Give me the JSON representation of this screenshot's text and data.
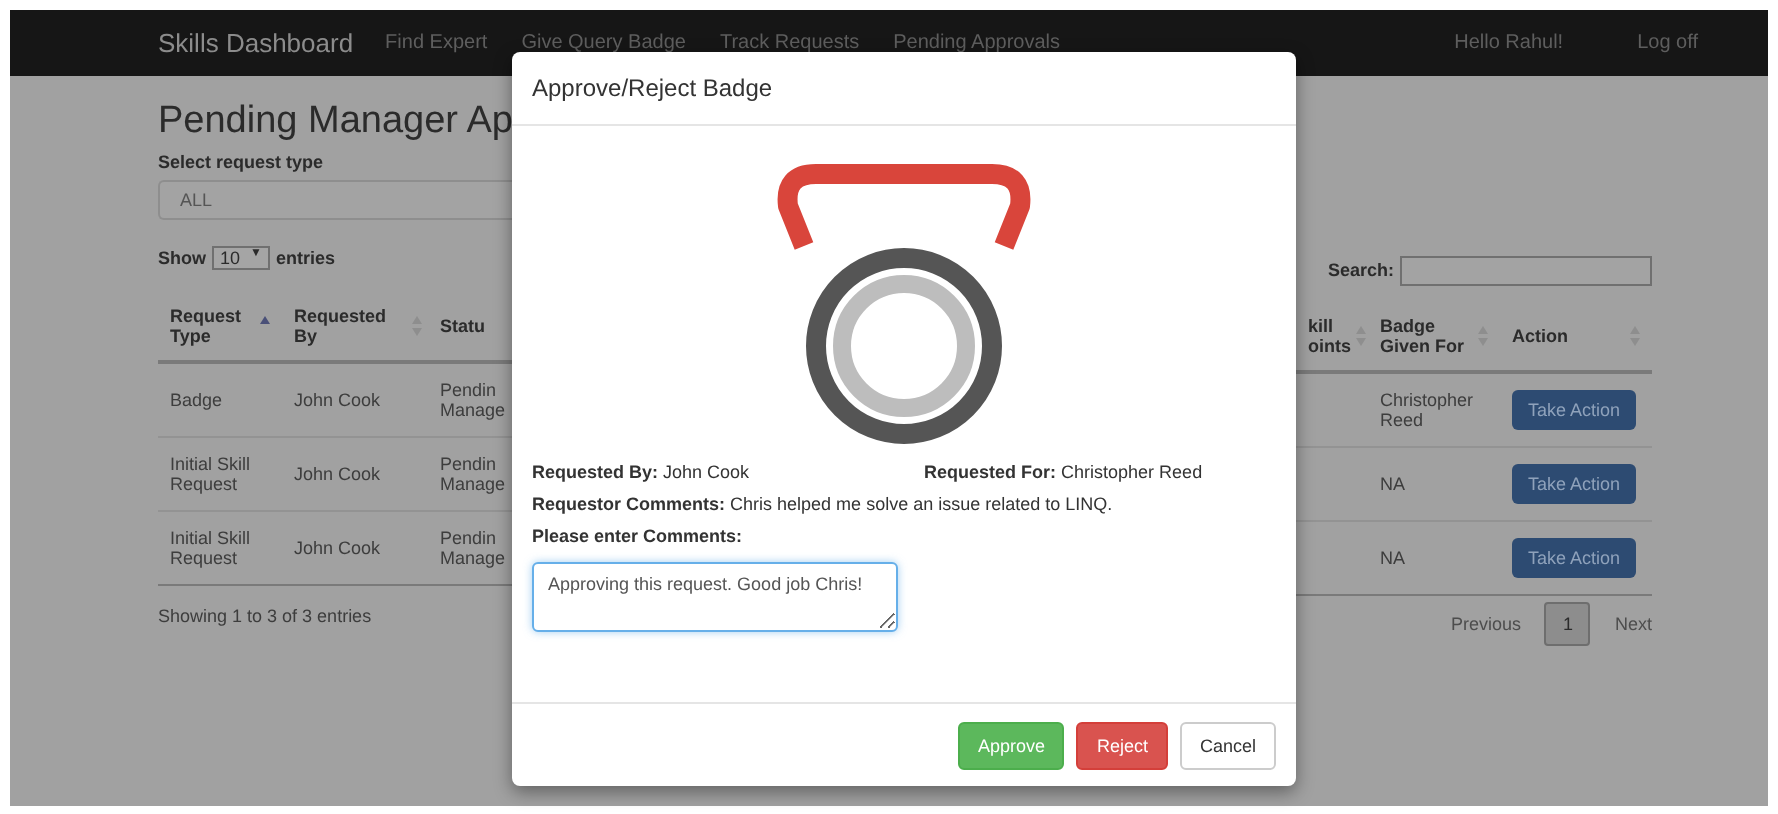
{
  "navbar": {
    "brand": "Skills Dashboard",
    "links": [
      "Find Expert",
      "Give Query Badge",
      "Track Requests",
      "Pending Approvals"
    ],
    "greeting": "Hello Rahul!",
    "logout": "Log off"
  },
  "page": {
    "title": "Pending Manager Ap",
    "filter_label": "Select request type",
    "filter_value": "ALL",
    "length_prefix": "Show",
    "length_value": "10",
    "length_suffix": "entries",
    "search_label": "Search:",
    "length_caret": "▼",
    "table_left": {
      "columns": [
        {
          "label": "Request Type",
          "sorted": true
        },
        {
          "label": "Requested By",
          "sorted": false
        },
        {
          "label": "Statu"
        }
      ],
      "rows": [
        [
          "Badge",
          "John Cook",
          "Pendin Manage"
        ],
        [
          "Initial Skill Request",
          "John Cook",
          "Pendin Manage"
        ],
        [
          "Initial Skill Request",
          "John Cook",
          "Pendin Manage"
        ]
      ]
    },
    "table_right": {
      "columns": [
        {
          "label": "kill oints",
          "sorted": false
        },
        {
          "label": "Badge Given For",
          "sorted": false
        },
        {
          "label": "Action",
          "sorted": false
        }
      ],
      "rows": [
        {
          "given_for": "Christopher Reed",
          "action": "Take Action"
        },
        {
          "given_for": "NA",
          "action": "Take Action"
        },
        {
          "given_for": "NA",
          "action": "Take Action"
        }
      ]
    },
    "info": "Showing 1 to 3 of 3 entries",
    "pagination": {
      "previous": "Previous",
      "pages": [
        {
          "label": "1",
          "selected": true
        }
      ],
      "next": "Next"
    }
  },
  "modal": {
    "title": "Approve/Reject Badge",
    "requested_by_label": "Requested By:",
    "requested_by": "John Cook",
    "requested_for_label": "Requested For:",
    "requested_for": "Christopher Reed",
    "comments_label": "Requestor Comments:",
    "comments": "Chris helped me solve an issue related to LINQ.",
    "input_label": "Please enter Comments:",
    "input_value": "Approving this request. Good job Chris!",
    "buttons": [
      {
        "label": "Approve",
        "kind": "success"
      },
      {
        "label": "Reject",
        "kind": "danger"
      },
      {
        "label": "Cancel",
        "kind": "default"
      }
    ]
  }
}
